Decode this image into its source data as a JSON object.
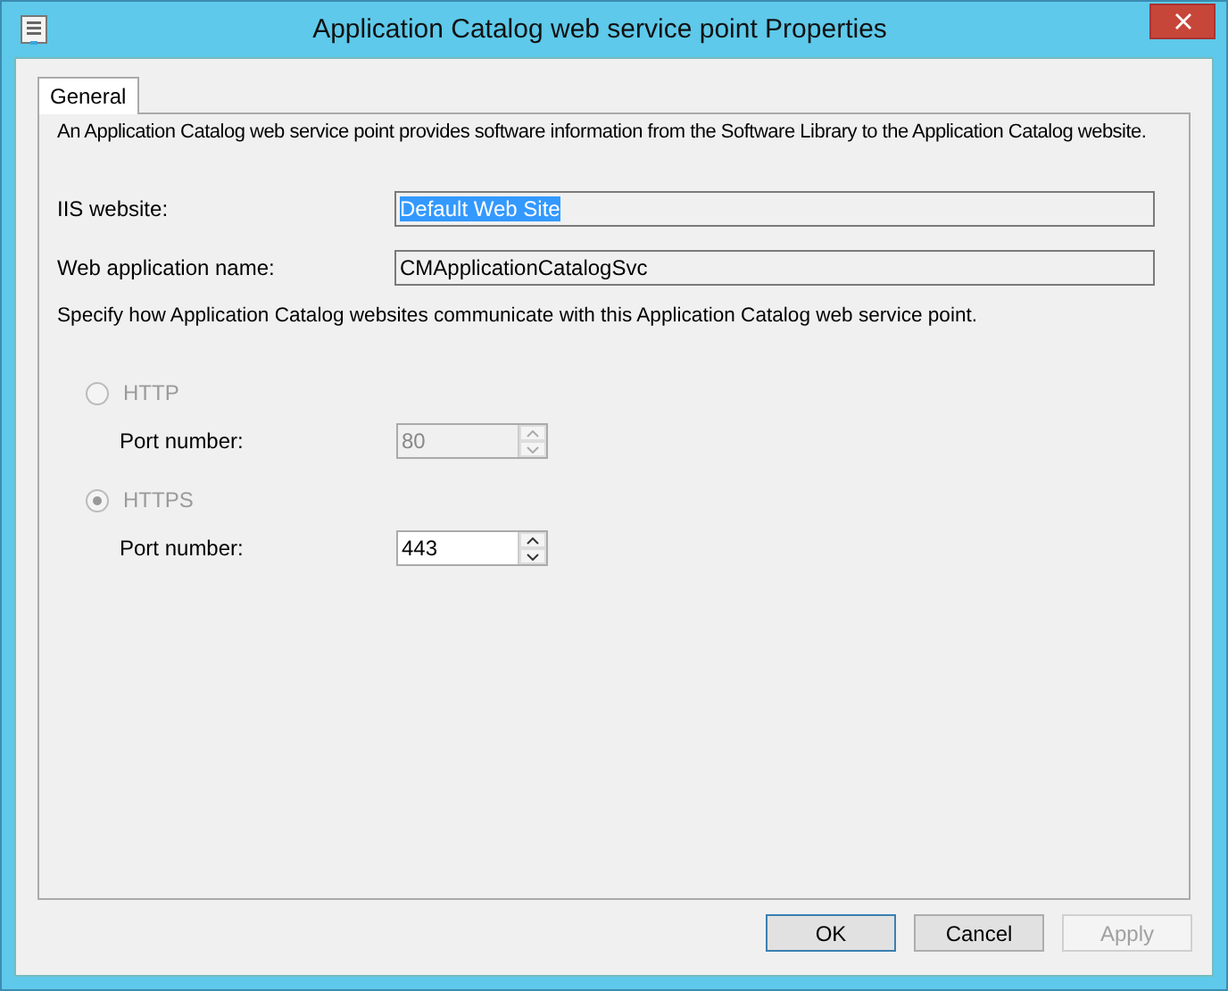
{
  "window": {
    "title": "Application Catalog web service point Properties"
  },
  "tabs": [
    {
      "label": "General",
      "selected": true
    }
  ],
  "description": "An Application Catalog web service point provides software information from the Software Library to the Application Catalog website.",
  "fields": [
    {
      "label": "IIS website:",
      "value": "Default Web Site",
      "highlighted": true
    },
    {
      "label": "Web application name:",
      "value": "CMApplicationCatalogSvc",
      "highlighted": false
    }
  ],
  "instruction": "Specify how Application Catalog websites communicate with this Application Catalog web service point.",
  "protocols": [
    {
      "label": "HTTP",
      "selected": false,
      "disabled": true,
      "port_label": "Port number:",
      "port": "80",
      "port_disabled": true
    },
    {
      "label": "HTTPS",
      "selected": true,
      "disabled": true,
      "port_label": "Port number:",
      "port": "443",
      "port_disabled": false
    }
  ],
  "buttons": [
    {
      "label": "OK",
      "default": true,
      "disabled": false
    },
    {
      "label": "Cancel",
      "default": false,
      "disabled": false
    },
    {
      "label": "Apply",
      "default": false,
      "disabled": true
    }
  ]
}
